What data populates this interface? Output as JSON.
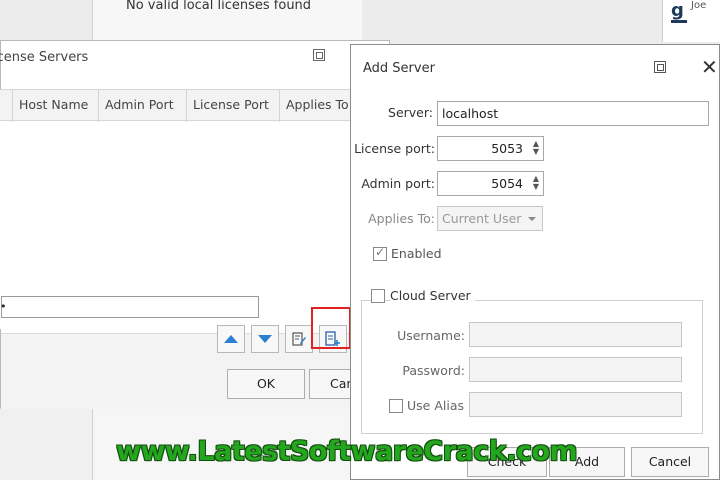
{
  "background": {
    "top_message": "No valid local licenses found"
  },
  "license_servers": {
    "title": "icense Servers",
    "columns": [
      "Host Name",
      "Admin Port",
      "License Port",
      "Applies To"
    ],
    "input_marker": "•",
    "ok_label": "OK",
    "cancel_label": "Can"
  },
  "add_server": {
    "title": "Add Server",
    "server_label": "Server:",
    "server_value": "localhost",
    "license_port_label": "License port:",
    "license_port_value": "5053",
    "admin_port_label": "Admin port:",
    "admin_port_value": "5054",
    "applies_to_label": "Applies To:",
    "applies_to_value": "Current User",
    "enabled_label": "Enabled",
    "enabled_checked": true,
    "cloud_server_label": "Cloud Server",
    "cloud_server_checked": false,
    "username_label": "Username:",
    "password_label": "Password:",
    "use_alias_label": "Use Alias",
    "check_label": "Check",
    "add_label": "Add",
    "cancel_label": "Cancel"
  },
  "watermark": "www.LatestSoftwareCrack.com",
  "colors": {
    "accent_blue": "#2a7fd1",
    "highlight_red": "#e32222",
    "watermark_green": "#24a61e"
  }
}
